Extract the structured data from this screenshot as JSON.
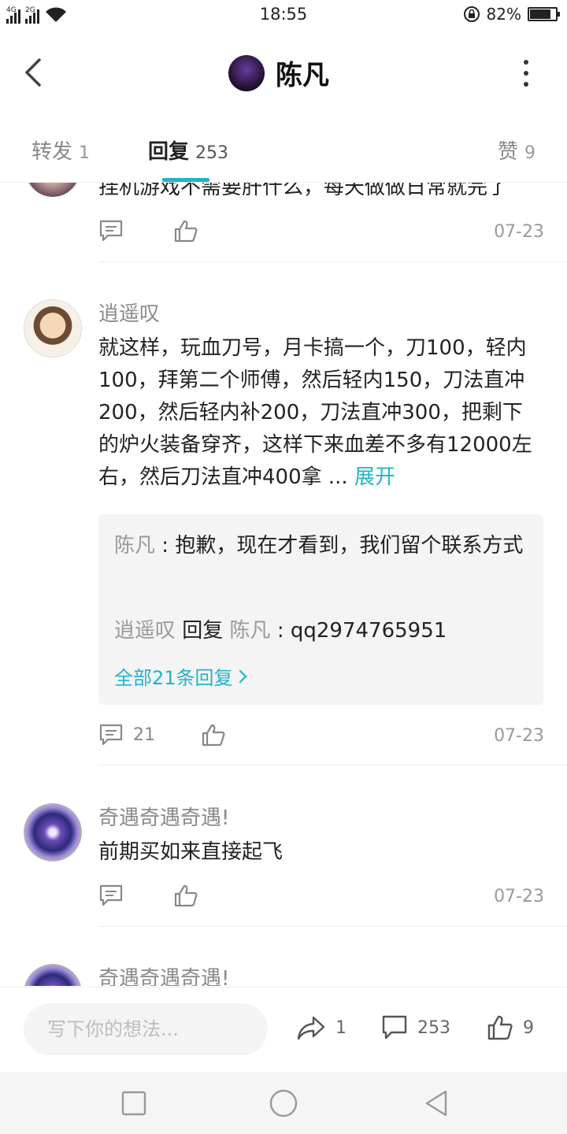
{
  "status_bar": {
    "net1": "4G",
    "net2": "2G",
    "time": "18:55",
    "battery_text": "82%",
    "battery_level": 0.82
  },
  "header": {
    "title": "陈凡",
    "back_icon": "chevron-left-icon",
    "more_icon": "more-vertical-icon"
  },
  "tabs": [
    {
      "label": "转发",
      "count": "1"
    },
    {
      "label": "回复",
      "count": "253",
      "active": true
    },
    {
      "label": "赞",
      "count": "9"
    }
  ],
  "comments": [
    {
      "name": "",
      "text": "挂机游戏不需要肝什么，每天做做日常就完了",
      "reply_count": "",
      "date": "07-23"
    },
    {
      "name": "逍遥叹",
      "text": "就这样，玩血刀号，月卡搞一个，刀100，轻内100，拜第二个师傅，然后轻内150，刀法直冲200，然后轻内补200，刀法直冲300，把剩下的炉火装备穿齐，这样下来血差不多有12000左右，然后刀法直冲400拿 ...",
      "expand_label": "展开",
      "replies": [
        {
          "user": "陈凡",
          "sep": " : ",
          "text": "抱歉，现在才看到，我们留个联系方式"
        },
        {
          "user": "逍遥叹",
          "mid": " 回复 ",
          "target": "陈凡",
          "sep": " : ",
          "text": "qq2974765951"
        }
      ],
      "all_replies_label": "全部21条回复",
      "reply_count": "21",
      "date": "07-23"
    },
    {
      "name": "奇遇奇遇奇遇!",
      "text": "前期买如来直接起飞",
      "reply_count": "",
      "date": "07-23"
    },
    {
      "name": "奇遇奇遇奇遇!",
      "text": ""
    }
  ],
  "input_bar": {
    "placeholder": "写下你的想法...",
    "share_count": "1",
    "comment_count": "253",
    "like_count": "9"
  },
  "colors": {
    "accent": "#1fb4c8",
    "muted_text": "#8a8a8a",
    "reply_bg": "#f4f4f4"
  }
}
